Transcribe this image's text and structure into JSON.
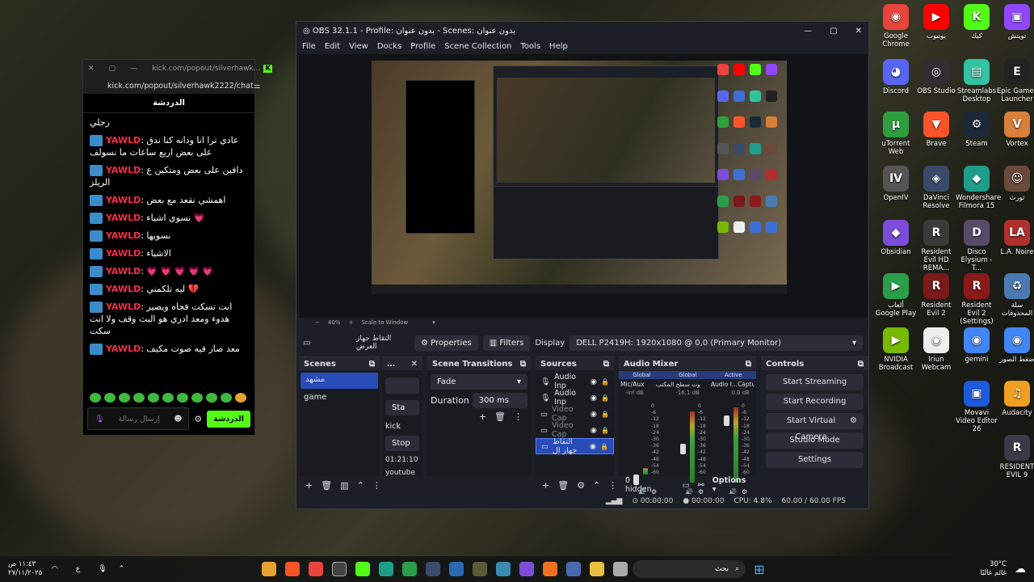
{
  "obs": {
    "title": "OBS 32.1.1 - Profile: بدون عنوان - Scenes: بدون عنوان",
    "menu": [
      "File",
      "Edit",
      "View",
      "Docks",
      "Profile",
      "Scene Collection",
      "Tools",
      "Help"
    ],
    "zoom": "40%",
    "scale_mode": "Scale to Window",
    "source_bar": {
      "selected_source": "التقاط جهاز العرض",
      "properties": "Properties",
      "filters": "Filters",
      "display_label": "Display",
      "display_value": "DELL P2419H: 1920x1080 @ 0,0 (Primary Monitor)"
    },
    "scenes": {
      "title": "Scenes",
      "items": [
        "مشهد",
        "game"
      ]
    },
    "middle_dock": {
      "start_label": "Sta",
      "kick": "kick",
      "stop": "Stop",
      "time": "01:21:10",
      "youtube": "youtube"
    },
    "transitions": {
      "title": "Scene Transitions",
      "type": "Fade",
      "duration_label": "Duration",
      "duration_value": "300 ms"
    },
    "sources": {
      "title": "Sources",
      "items": [
        "Audio Inp",
        "Audio Inp",
        "Video Cap",
        "Video Cap",
        "التقاط جهاز ال"
      ]
    },
    "audio_mixer": {
      "title": "Audio Mixer",
      "tabs": [
        "Global",
        "Global",
        "Active"
      ],
      "channels": [
        {
          "name": "Mic/Aux",
          "db": "-inf dB"
        },
        {
          "name": "صوت سطح المكتب",
          "db": "-16.1 dB"
        },
        {
          "name": "Audio I...Capture",
          "db": "0.0 dB"
        }
      ],
      "scale": [
        "0",
        "-6",
        "-12",
        "-18",
        "-24",
        "-30",
        "-36",
        "-42",
        "-48",
        "-54",
        "-60"
      ],
      "hidden": "0 hidden",
      "options": "Options"
    },
    "controls": {
      "title": "Controls",
      "buttons": [
        "Start Streaming",
        "Start Recording",
        "Start Virtual Camera",
        "Studio Mode",
        "Settings"
      ]
    },
    "status": {
      "stream_time": "00:00:00",
      "rec_time": "00:00:00",
      "cpu": "CPU: 4.8%",
      "fps": "60.00 / 60.00 FPS"
    }
  },
  "chat": {
    "url_short": "kick.com/popout/silverhawk...",
    "url": "kick.com/popout/silverhawk2222/chat",
    "header": "الدردشة",
    "first_line": "رجلي",
    "messages": [
      {
        "user": "YAWLD",
        "text": "عادي ترا انا ودانه كنا ندق على بعض اربع ساعات ما نسولف"
      },
      {
        "user": "YAWLD",
        "text": "دافين على بعض ومتكين ع الريلز"
      },
      {
        "user": "YAWLD",
        "text": "اهمشي نقعد مع بعض"
      },
      {
        "user": "YAWLD",
        "text": "نسوي اشياء 💗"
      },
      {
        "user": "YAWLD",
        "text": "نسويها"
      },
      {
        "user": "YAWLD",
        "text": "الاشياء"
      },
      {
        "user": "YAWLD",
        "text": "💗 💗 💗 💗 💗"
      },
      {
        "user": "YAWLD",
        "text": "ليه تلكمني 💔"
      },
      {
        "user": "YAWLD",
        "text": "انت تسكت فجاه ويصير هدوء ومعد ادري هو البث وقف ولا انت سكت"
      },
      {
        "user": "YAWLD",
        "text": "معد صار فيه صوت مكيف"
      }
    ],
    "input_placeholder": "إرسال رسالة",
    "send_label": "الدردشة"
  },
  "desktop_icons": [
    {
      "label": "Google Chrome",
      "color": "#e8453c",
      "glyph": "◉"
    },
    {
      "label": "يوتيوب",
      "color": "#ff0000",
      "glyph": "▶"
    },
    {
      "label": "كيك",
      "color": "#53fc18",
      "glyph": "K"
    },
    {
      "label": "تويتش",
      "color": "#9146ff",
      "glyph": "▣"
    },
    {
      "label": "Discord",
      "color": "#5865f2",
      "glyph": "◕"
    },
    {
      "label": "OBS Studio",
      "color": "#302e31",
      "glyph": "◎"
    },
    {
      "label": "Streamlabs Desktop",
      "color": "#31c3a2",
      "glyph": "▤"
    },
    {
      "label": "Epic Games Launcher",
      "color": "#222222",
      "glyph": "E"
    },
    {
      "label": "uTorrent Web",
      "color": "#2e9e3e",
      "glyph": "µ"
    },
    {
      "label": "Brave",
      "color": "#fb542b",
      "glyph": "▼"
    },
    {
      "label": "Steam",
      "color": "#1b2838",
      "glyph": "⚙"
    },
    {
      "label": "Vortex",
      "color": "#d8803a",
      "glyph": "V"
    },
    {
      "label": "OpenIV",
      "color": "#555555",
      "glyph": "IV"
    },
    {
      "label": "DaVinci Resolve",
      "color": "#3a4a6a",
      "glyph": "◈"
    },
    {
      "label": "Wondershare Filmora 15",
      "color": "#1e9e8a",
      "glyph": "◆"
    },
    {
      "label": "ثورث",
      "color": "#6a4a3a",
      "glyph": "☺"
    },
    {
      "label": "Obsidian",
      "color": "#7c4ddb",
      "glyph": "◆"
    },
    {
      "label": "Resident Evil HD REMA...",
      "color": "#3a3a3a",
      "glyph": "R"
    },
    {
      "label": "Disco Elysium - T...",
      "color": "#5a4a6a",
      "glyph": "D"
    },
    {
      "label": "L.A. Noire",
      "color": "#b03030",
      "glyph": "LA"
    },
    {
      "label": "ألعاب Google Play",
      "color": "#2a9e4a",
      "glyph": "▶"
    },
    {
      "label": "Resident Evil 2",
      "color": "#7a1a1a",
      "glyph": "R"
    },
    {
      "label": "Resident Evil 2 (Settings)",
      "color": "#8a1a1a",
      "glyph": "R"
    },
    {
      "label": "سلة المحذوفات",
      "color": "#4a7ab0",
      "glyph": "♻"
    },
    {
      "label": "NVIDIA Broadcast",
      "color": "#76b900",
      "glyph": "▶"
    },
    {
      "label": "Iriun Webcam",
      "color": "#eeeeee",
      "glyph": "◉"
    },
    {
      "label": "gemini",
      "color": "#4285f4",
      "glyph": "◉"
    },
    {
      "label": "ضغط الصور",
      "color": "#4285f4",
      "glyph": "◉"
    },
    {
      "label": "Movavi Video Editor 26",
      "color": "#1e5adc",
      "glyph": "▣"
    },
    {
      "label": "Audacity",
      "color": "#f0a020",
      "glyph": "♫"
    },
    {
      "label": "RESIDENT EVIL 9",
      "color": "#3a3a4a",
      "glyph": "R"
    }
  ],
  "taskbar": {
    "search_placeholder": "بحث",
    "weather_temp": "30°C",
    "weather_desc": "غائم غالبًا",
    "clock_time": "١١:٤٣ ص",
    "clock_date": "٢٧/١١/٢٠٢٥",
    "lang": "ع"
  }
}
